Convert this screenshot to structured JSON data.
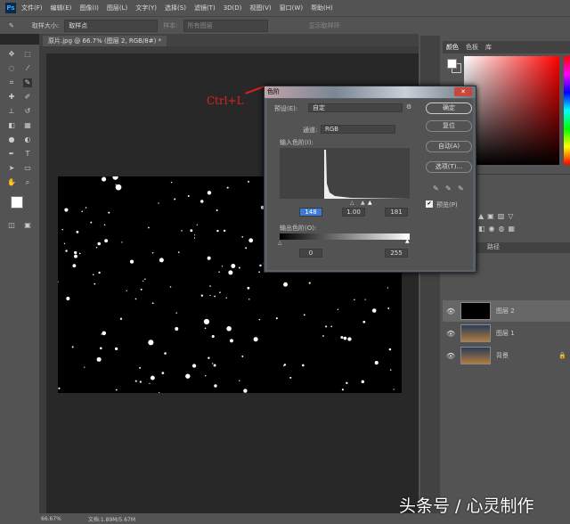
{
  "app": {
    "logo": "Ps"
  },
  "menu": [
    "文件(F)",
    "编辑(E)",
    "图像(I)",
    "图层(L)",
    "文字(Y)",
    "选择(S)",
    "滤镜(T)",
    "3D(D)",
    "视图(V)",
    "窗口(W)",
    "帮助(H)"
  ],
  "options": {
    "sample_size_label": "取样大小:",
    "sample_size_value": "取样点",
    "sample_label": "样本:",
    "sample_value": "所有图层",
    "show_ring": "显示取样环"
  },
  "document_tab": "原片.jpg @ 66.7% (图层 2, RGB/8#) *",
  "status": {
    "zoom": "66.67%",
    "doc": "文档:1.89M/5.67M"
  },
  "annotation": "Ctrl+L",
  "watermark": "头条号 / 心灵制作",
  "color_panel": {
    "tabs": [
      "颜色",
      "色板",
      "库"
    ]
  },
  "layers_panel": {
    "tab": "路径",
    "layers": [
      {
        "name": "图层 2",
        "active": true
      },
      {
        "name": "图层 1",
        "active": false
      },
      {
        "name": "背景",
        "active": false,
        "locked": true
      }
    ]
  },
  "levels_dialog": {
    "title": "色阶",
    "preset_label": "预设(E):",
    "preset_value": "自定",
    "channel_label": "通道:",
    "channel_value": "RGB",
    "input_label": "输入色阶(I):",
    "input_black": "148",
    "input_gamma": "1.00",
    "input_white": "181",
    "output_label": "输出色阶(O):",
    "output_black": "0",
    "output_white": "255",
    "buttons": {
      "ok": "确定",
      "reset": "复位",
      "auto": "自动(A)",
      "options": "选项(T)..."
    },
    "preview_label": "预览(P)",
    "preview_checked": true
  }
}
